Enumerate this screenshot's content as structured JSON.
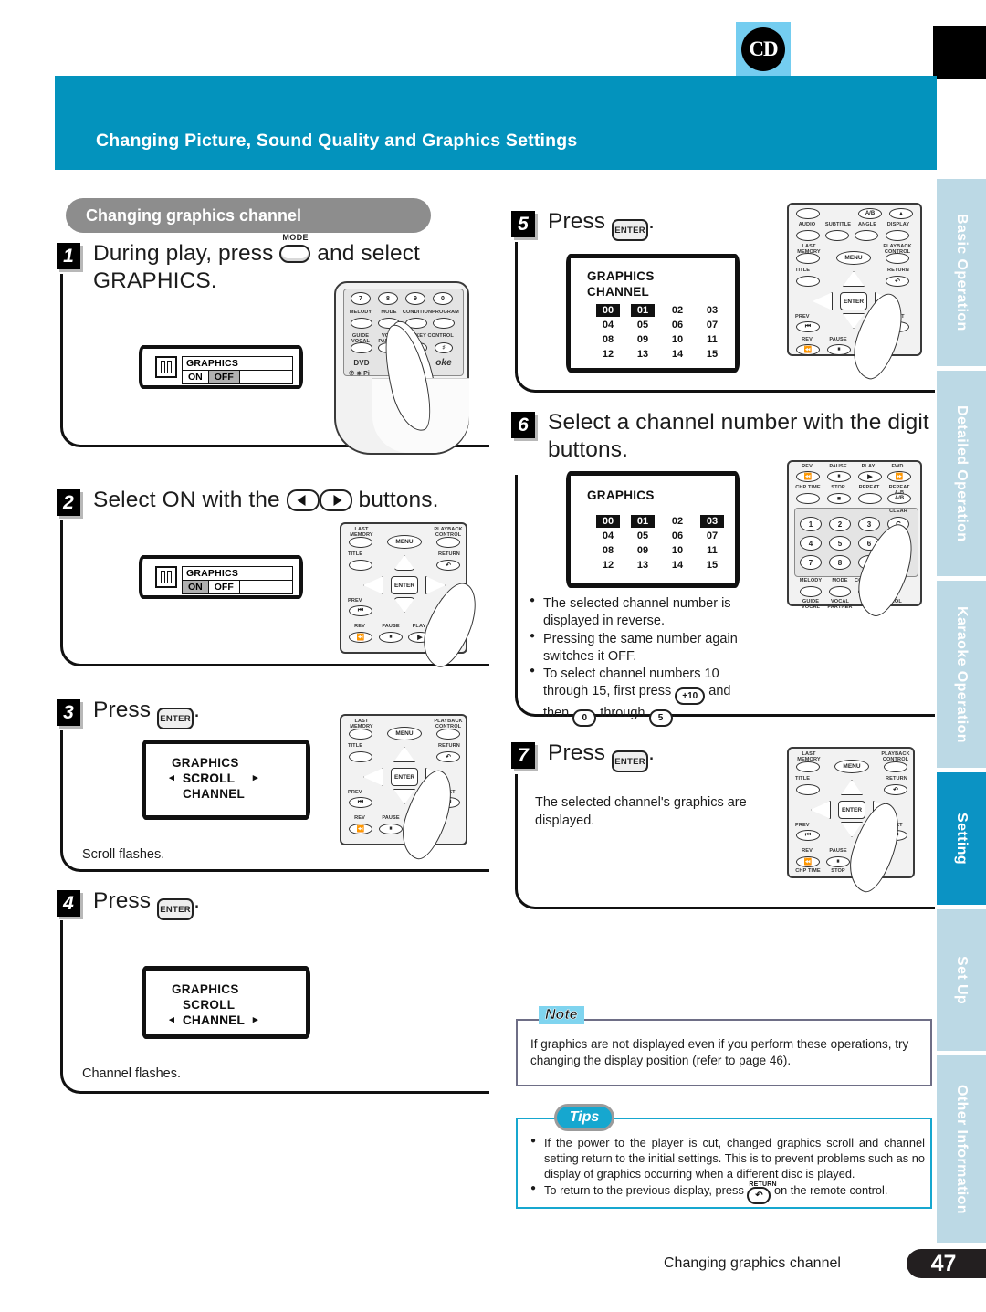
{
  "header": {
    "title": "Changing Picture, Sound Quality and Graphics Settings",
    "cd_logo": "CD"
  },
  "section": {
    "pill_label": "Changing graphics channel"
  },
  "steps": [
    {
      "num": "1",
      "text_before": "During play, press",
      "button": "MODE",
      "text_after": "and select GRAPHICS.",
      "osd": {
        "title": "GRAPHICS",
        "options": [
          "ON",
          "OFF"
        ],
        "selected": "OFF"
      }
    },
    {
      "num": "2",
      "text": "Select ON with the",
      "text_after": "buttons.",
      "osd": {
        "title": "GRAPHICS",
        "options": [
          "ON",
          "OFF"
        ],
        "selected": "ON"
      }
    },
    {
      "num": "3",
      "text": "Press",
      "button": "ENTER",
      "osd_lines": [
        "GRAPHICS",
        "SCROLL",
        "CHANNEL"
      ],
      "flashing": "SCROLL",
      "caption": "Scroll flashes."
    },
    {
      "num": "4",
      "text": "Press",
      "button": "ENTER",
      "osd_lines": [
        "GRAPHICS",
        "SCROLL",
        "CHANNEL"
      ],
      "flashing": "CHANNEL",
      "caption": "Channel flashes."
    },
    {
      "num": "5",
      "text": "Press",
      "button": "ENTER",
      "osd_title": "GRAPHICS",
      "osd_subtitle": "CHANNEL",
      "channels": [
        "00",
        "01",
        "02",
        "03",
        "04",
        "05",
        "06",
        "07",
        "08",
        "09",
        "10",
        "11",
        "12",
        "13",
        "14",
        "15"
      ],
      "reversed": [
        "00",
        "01"
      ]
    },
    {
      "num": "6",
      "text": "Select a channel number with the digit buttons.",
      "osd_title": "GRAPHICS",
      "channels": [
        "00",
        "01",
        "02",
        "03",
        "04",
        "05",
        "06",
        "07",
        "08",
        "09",
        "10",
        "11",
        "12",
        "13",
        "14",
        "15"
      ],
      "reversed": [
        "00",
        "01",
        "03"
      ],
      "bullets": [
        "The selected channel number is displayed in reverse.",
        "Pressing the same number again switches it OFF.",
        "To select channel numbers 10 through 15, first press +10 and then 0 through 5."
      ],
      "bullet3_parts": {
        "a": "To select channel numbers 10",
        "b": "through 15, first press",
        "key1": "+10",
        "c": "and",
        "d": "then",
        "key2": "0",
        "e": "through",
        "key3": "5",
        "f": "."
      }
    },
    {
      "num": "7",
      "text": "Press",
      "button": "ENTER",
      "caption": "The selected channel's graphics are displayed."
    }
  ],
  "note": {
    "badge": "Note",
    "text": "If graphics are not displayed even if you perform these operations, try changing the display position (refer to page 46)."
  },
  "tips": {
    "badge": "Tips",
    "items": [
      "If the power to the player is cut, changed graphics scroll and channel setting return to the initial settings. This is to prevent problems such as no display of graphics occurring when a different disc is played.",
      "To return to the previous display, press"
    ],
    "item2_tail": "on the remote control.",
    "item2_key": "RETURN"
  },
  "sidebar": {
    "tabs": [
      {
        "label": "Basic Operation",
        "active": false
      },
      {
        "label": "Detailed Operation",
        "active": false
      },
      {
        "label": "Karaoke Operation",
        "active": false
      },
      {
        "label": "Setting",
        "active": true
      },
      {
        "label": "Set Up",
        "active": false
      },
      {
        "label": "Other Information",
        "active": false
      }
    ]
  },
  "footer": {
    "text": "Changing graphics channel",
    "page": "47"
  },
  "remote_labels": {
    "digits_row": [
      "7",
      "8",
      "9",
      "0"
    ],
    "fn_row": [
      "MELODY",
      "MODE",
      "CONDITION",
      "PROGRAM"
    ],
    "fn_row2": [
      "GUIDE VOCAL",
      "VOCAL PARTNER",
      "KEY CONTROL"
    ],
    "brand": [
      "DVD",
      "DVD",
      "oke"
    ],
    "nav": [
      "LAST MEMORY",
      "MENU",
      "PLAYBACK CONTROL",
      "TITLE",
      "RETURN",
      "ENTER",
      "PREV",
      "NEXT"
    ],
    "transport": [
      "REV",
      "PAUSE",
      "PLAY",
      "FWD",
      "CHP TIME",
      "STOP",
      "REPEAT",
      "REPEAT A-B"
    ],
    "keypad": [
      "1",
      "2",
      "3",
      "C",
      "4",
      "5",
      "6",
      "+10",
      "7",
      "8",
      "9"
    ],
    "keypad_clear": "CLEAR",
    "top_row": [
      "AUDIO",
      "SUBTITLE",
      "ANGLE",
      "DISPLAY"
    ],
    "ab": "A/B"
  },
  "colors": {
    "header_blue": "#0393bd",
    "tab_light": "#bcd9e5",
    "tab_active": "#0b93c4",
    "pill_gray": "#8d8d8d",
    "tips_border": "#16a7cf",
    "note_badge": "#7fd4ef"
  }
}
